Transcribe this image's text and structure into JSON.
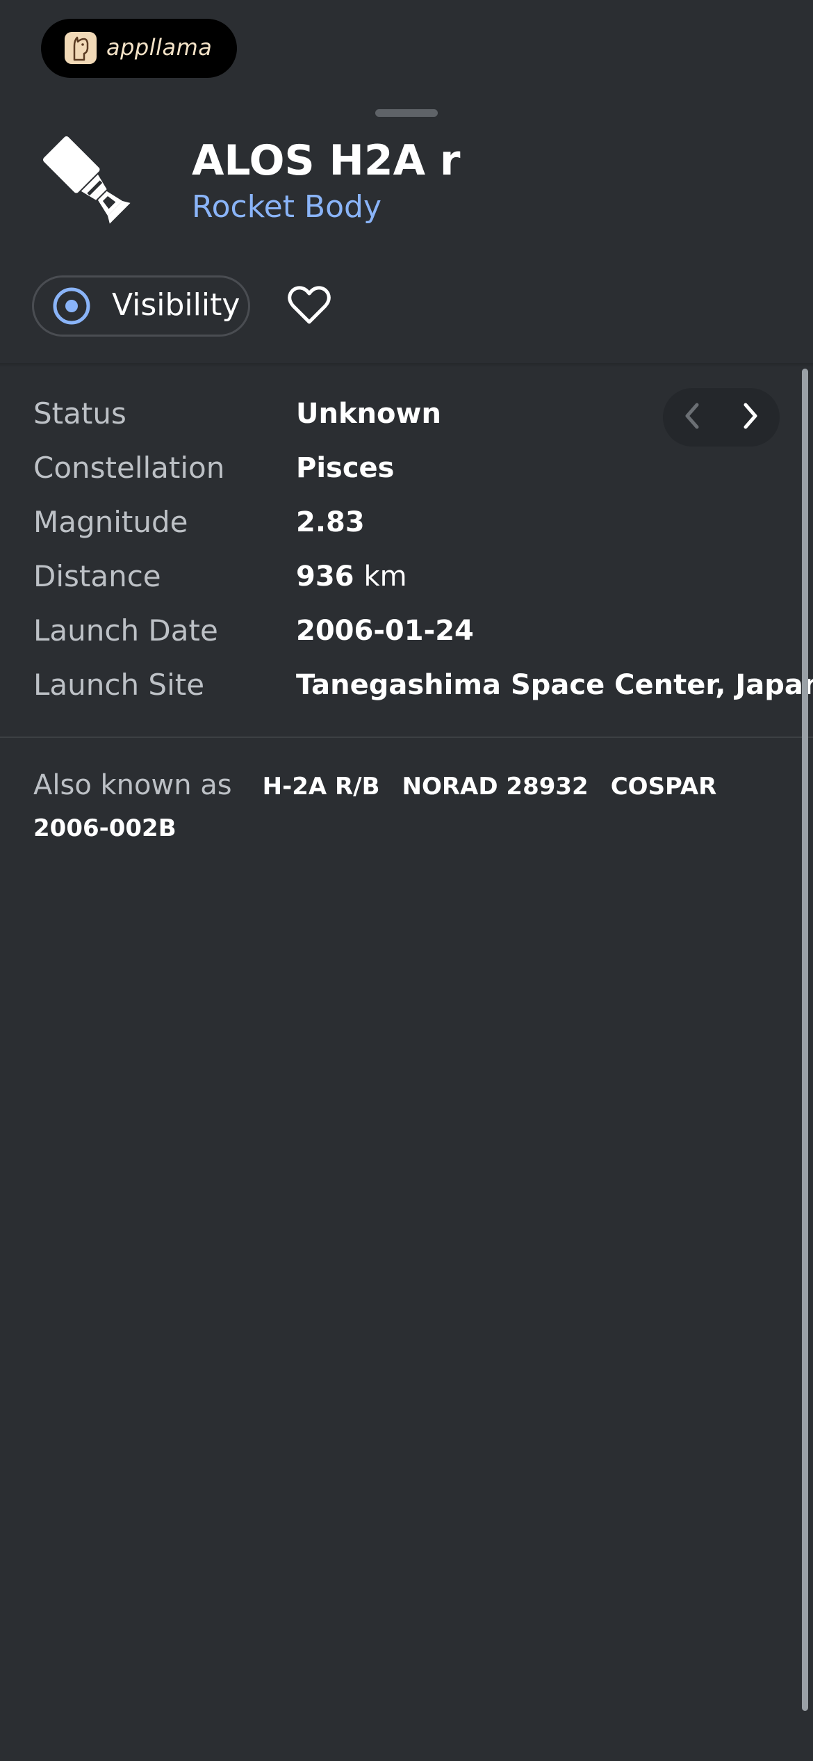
{
  "brand": {
    "name": "appllama"
  },
  "object": {
    "title": "ALOS H2A r",
    "type": "Rocket Body",
    "icon": "rocket-body-icon"
  },
  "actions": {
    "visibility_label": "Visibility",
    "favorite_icon": "heart-outline-icon"
  },
  "details": {
    "rows": [
      {
        "label": "Status",
        "value": "Unknown"
      },
      {
        "label": "Constellation",
        "value": "Pisces"
      },
      {
        "label": "Magnitude",
        "value": "2.83"
      },
      {
        "label": "Distance",
        "value": "936",
        "unit": "km"
      },
      {
        "label": "Launch Date",
        "value": "2006-01-24"
      },
      {
        "label": "Launch Site",
        "value": "Tanegashima Space Center, Japan"
      }
    ]
  },
  "pager": {
    "prev_icon": "chevron-left-icon",
    "next_icon": "chevron-right-icon"
  },
  "aka": {
    "label": "Also known as",
    "items": [
      "H-2A R/B",
      "NORAD 28932",
      "COSPAR 2006-002B"
    ]
  },
  "colors": {
    "background": "#2b2e32",
    "accent": "#8ab4f8",
    "label": "#bdc1c6"
  }
}
